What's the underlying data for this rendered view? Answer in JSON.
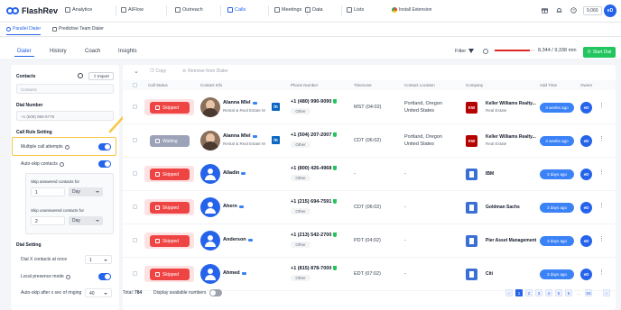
{
  "app": {
    "brand": "FlashRev"
  },
  "topnav": {
    "items": [
      {
        "label": "Analytice",
        "icon": "analytics-icon"
      },
      {
        "label": "AIFlow",
        "icon": "flow-icon"
      },
      {
        "label": "Outreach",
        "icon": "send-icon"
      },
      {
        "label": "Calls",
        "icon": "phone-icon"
      },
      {
        "label": "Meetings",
        "icon": "calendar-icon"
      },
      {
        "label": "Data",
        "icon": "database-icon"
      },
      {
        "label": "Lists",
        "icon": "list-icon"
      }
    ],
    "install": "Install Extension",
    "credits": "9,060",
    "user_initials": "eD"
  },
  "subnav": {
    "parallel": "Parallel Dialer",
    "predictive": "Predictive Team Dialer"
  },
  "tabs": [
    "Dialer",
    "History",
    "Coach",
    "Insights"
  ],
  "filter": {
    "label": "Filter",
    "minutes": "8,344 / 9,338 min",
    "used_fraction": 0.893,
    "start_label": "Start Dial"
  },
  "left": {
    "contacts_title": "Contacts",
    "import_label": "Import",
    "contacts_placeholder": "Contacts",
    "dial_number_title": "Dial Number",
    "dial_number_value": "+1 (509) 865-5775",
    "call_rule_title": "Call Rule Setting",
    "multiple_attempts": "Multiple call attempts",
    "auto_skip": "Auto-skip contacts",
    "skip_answered": "Skip answered contacts for",
    "skip_answered_num": "1",
    "skip_answered_unit": "Day",
    "skip_unanswered": "Skip unanswered contacts for",
    "skip_unanswered_num": "2",
    "skip_unanswered_unit": "Day",
    "dial_setting_title": "Dial Setting",
    "dial_x": "Dial X contacts at once",
    "dial_x_value": "1",
    "local_presence": "Local presence mode",
    "auto_skip_after": "Auto-skip after x sec of ringing",
    "auto_skip_after_value": "40"
  },
  "toolbar": {
    "copy": "Copy",
    "remove": "Remove from Dialer"
  },
  "headers": {
    "status": "Call Status",
    "contact": "Contact Info",
    "phone": "Phone Number",
    "timezone": "Timezone",
    "location": "Contact Location",
    "company": "Company",
    "added": "Add Time",
    "owner": "Owner"
  },
  "rows": [
    {
      "status": "Skipped",
      "name": "Alanna Mlel",
      "title": "Rental & Real Estate M",
      "phone": "+1 (480) 990-9090",
      "ptype": "Other",
      "tz": "MST (04:02)",
      "loc1": "Portland, Oregon",
      "loc2": "United States",
      "company": "Keller Williams Realty...",
      "company_sub": "Real Estate",
      "logo": "KW",
      "added": "3 weeks ago",
      "owner": "eD"
    },
    {
      "status": "Waiting",
      "name": "Alanna Mlel",
      "title": "Rental & Real Estate M",
      "phone": "+1 (504) 207-2007",
      "ptype": "Other",
      "tz": "CDT (06:02)",
      "loc1": "Portland, Oregon",
      "loc2": "United States",
      "company": "Keller Williams Realty...",
      "company_sub": "Real Estate",
      "logo": "KW",
      "added": "3 weeks ago",
      "owner": "eD"
    },
    {
      "status": "Skipped",
      "name": "Alladin",
      "title": "",
      "phone": "+1 (800) 426-4968",
      "ptype": "Other",
      "tz": "-",
      "loc1": "-",
      "loc2": "",
      "company": "IBM",
      "company_sub": "",
      "logo": "",
      "added": "3 days ago",
      "owner": "eD"
    },
    {
      "status": "Skipped",
      "name": "Ahern",
      "title": "",
      "phone": "+1 (215) 694-7591",
      "ptype": "Other",
      "tz": "CDT (06:02)",
      "loc1": "-",
      "loc2": "",
      "company": "Goldman Sachs",
      "company_sub": "",
      "logo": "",
      "added": "3 days ago",
      "owner": "eD"
    },
    {
      "status": "Skipped",
      "name": "Anderson",
      "title": "",
      "phone": "+1 (213) 542-2700",
      "ptype": "Other",
      "tz": "PDT (04:02)",
      "loc1": "-",
      "loc2": "",
      "company": "Pier Asset Management",
      "company_sub": "",
      "logo": "",
      "added": "3 days ago",
      "owner": "eD"
    },
    {
      "status": "Skipped",
      "name": "Ahmed",
      "title": "",
      "phone": "+1 (815) 878-7000",
      "ptype": "Other",
      "tz": "EDT (07:02)",
      "loc1": "-",
      "loc2": "",
      "company": "Citi",
      "company_sub": "",
      "logo": "",
      "added": "3 days ago",
      "owner": "eD"
    }
  ],
  "footer": {
    "total_label": "Total:",
    "total": "784",
    "display_available": "Display available numbers",
    "pages": [
      "1",
      "2",
      "3",
      "4",
      "5",
      "6",
      "...",
      "53"
    ]
  }
}
